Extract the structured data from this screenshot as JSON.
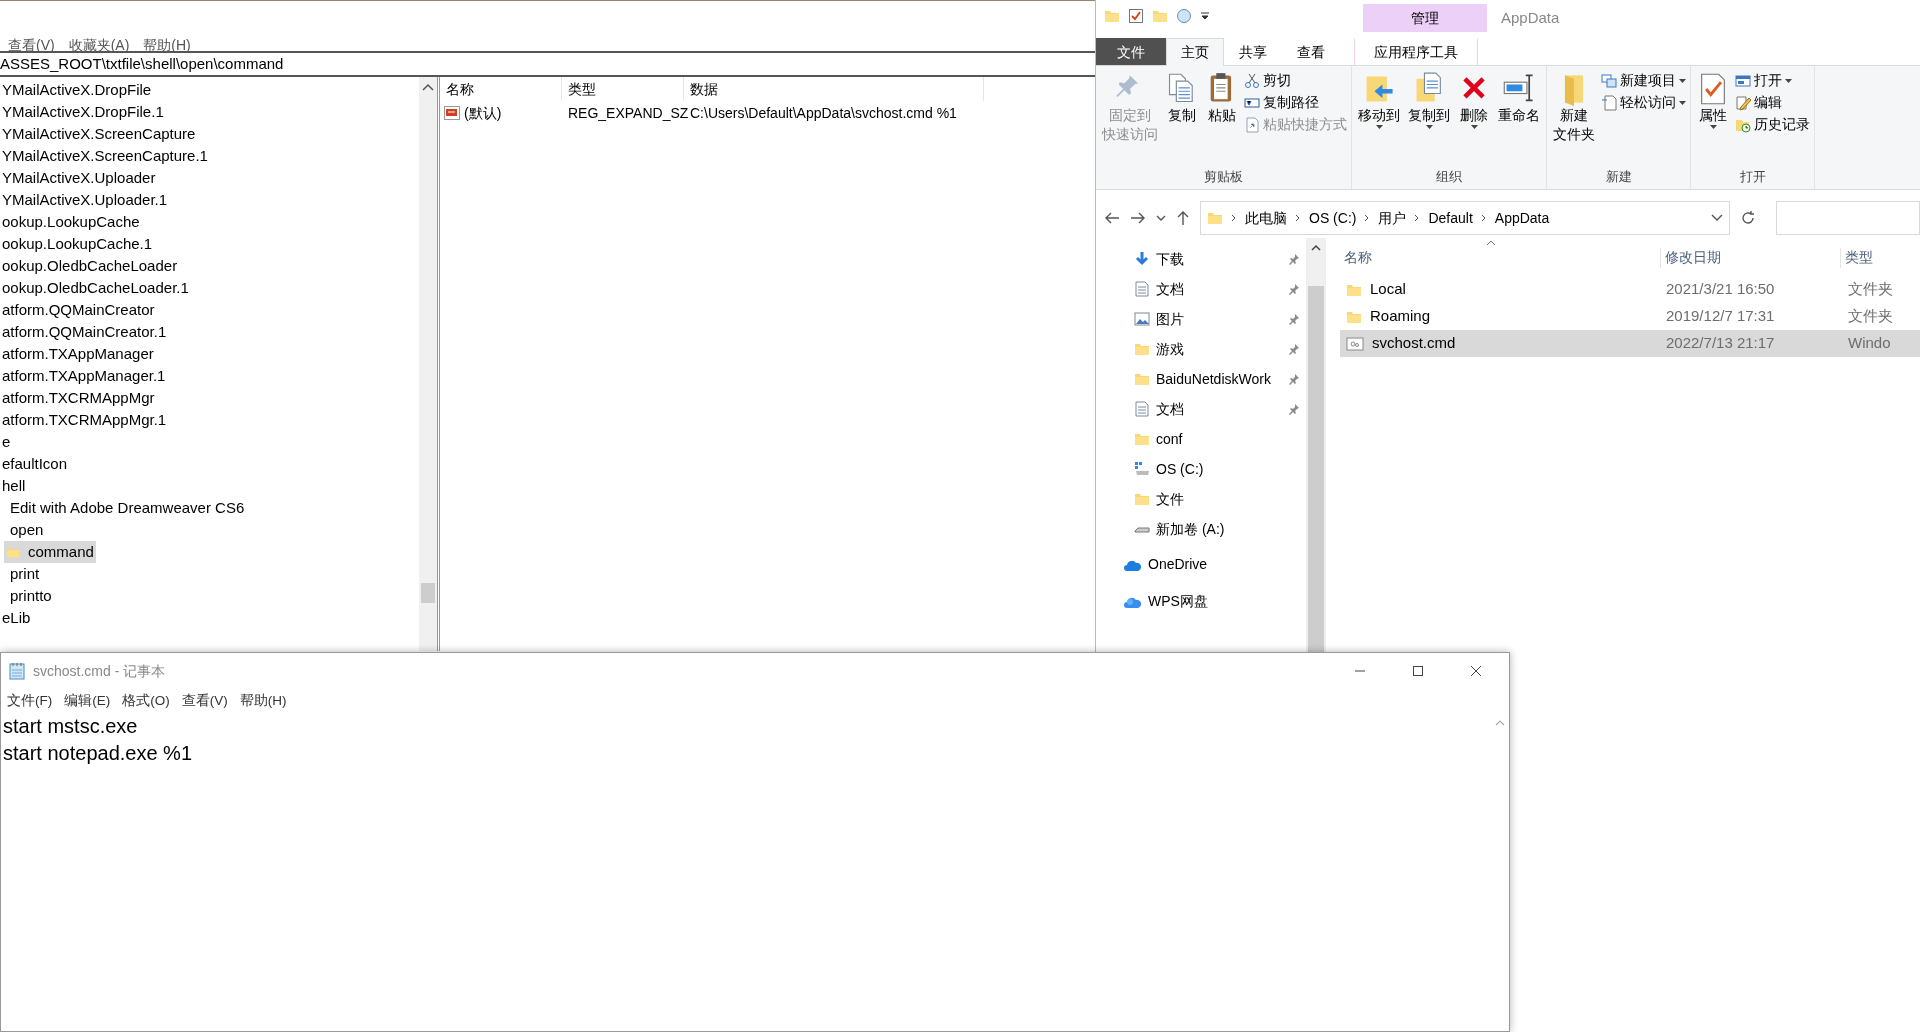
{
  "registry_editor": {
    "menu": [
      "查看(V)",
      "收藏夹(A)",
      "帮助(H)"
    ],
    "address": "ASSES_ROOT\\txtfile\\shell\\open\\command",
    "tree": [
      {
        "label": "YMailActiveX.DropFile",
        "selected": false
      },
      {
        "label": "YMailActiveX.DropFile.1",
        "selected": false
      },
      {
        "label": "YMailActiveX.ScreenCapture",
        "selected": false
      },
      {
        "label": "YMailActiveX.ScreenCapture.1",
        "selected": false
      },
      {
        "label": "YMailActiveX.Uploader",
        "selected": false
      },
      {
        "label": "YMailActiveX.Uploader.1",
        "selected": false
      },
      {
        "label": "ookup.LookupCache",
        "selected": false
      },
      {
        "label": "ookup.LookupCache.1",
        "selected": false
      },
      {
        "label": "ookup.OledbCacheLoader",
        "selected": false
      },
      {
        "label": "ookup.OledbCacheLoader.1",
        "selected": false
      },
      {
        "label": "atform.QQMainCreator",
        "selected": false
      },
      {
        "label": "atform.QQMainCreator.1",
        "selected": false
      },
      {
        "label": "atform.TXAppManager",
        "selected": false
      },
      {
        "label": "atform.TXAppManager.1",
        "selected": false
      },
      {
        "label": "atform.TXCRMAppMgr",
        "selected": false
      },
      {
        "label": "atform.TXCRMAppMgr.1",
        "selected": false
      },
      {
        "label": "e",
        "selected": false,
        "children": [
          {
            "label": "efaultIcon",
            "selected": false
          },
          {
            "label": "hell",
            "selected": false,
            "children": [
              {
                "label": "Edit with Adobe Dreamweaver CS6",
                "selected": false
              },
              {
                "label": "open",
                "selected": false,
                "children": [
                  {
                    "label": "command",
                    "selected": true
                  }
                ]
              },
              {
                "label": "print",
                "selected": false
              },
              {
                "label": "printto",
                "selected": false
              }
            ]
          }
        ]
      },
      {
        "label": "eLib",
        "selected": false
      }
    ],
    "values": {
      "columns": [
        "名称",
        "类型",
        "数据"
      ],
      "rows": [
        {
          "name": "(默认)",
          "type": "REG_EXPAND_SZ",
          "data": "C:\\Users\\Default\\AppData\\svchost.cmd %1"
        }
      ]
    }
  },
  "file_explorer": {
    "contextual_tab": "管理",
    "window_title": "AppData",
    "tabs": [
      {
        "label": "文件",
        "kind": "file",
        "selected": false
      },
      {
        "label": "主页",
        "kind": "normal",
        "selected": true
      },
      {
        "label": "共享",
        "kind": "normal",
        "selected": false
      },
      {
        "label": "查看",
        "kind": "normal",
        "selected": false
      },
      {
        "label": "应用程序工具",
        "kind": "contextual",
        "selected": false
      }
    ],
    "ribbon": [
      {
        "label": "剪贴板",
        "large": [
          {
            "lines": [
              "固定到",
              "快速访问"
            ],
            "disabled": true,
            "dropdown": false
          },
          {
            "lines": [
              "复制"
            ],
            "disabled": false,
            "dropdown": false
          },
          {
            "lines": [
              "粘贴"
            ],
            "disabled": false,
            "dropdown": false
          }
        ],
        "small": [
          {
            "label": "剪切",
            "disabled": false,
            "dropdown": false
          },
          {
            "label": "复制路径",
            "disabled": false,
            "dropdown": false
          },
          {
            "label": "粘贴快捷方式",
            "disabled": true,
            "dropdown": false
          }
        ]
      },
      {
        "label": "组织",
        "large": [
          {
            "lines": [
              "移动到"
            ],
            "disabled": false,
            "dropdown": true
          },
          {
            "lines": [
              "复制到"
            ],
            "disabled": false,
            "dropdown": true
          },
          {
            "lines": [
              "删除"
            ],
            "disabled": false,
            "dropdown": true
          },
          {
            "lines": [
              "重命名"
            ],
            "disabled": false,
            "dropdown": false
          }
        ]
      },
      {
        "label": "新建",
        "large": [
          {
            "lines": [
              "新建",
              "文件夹"
            ],
            "disabled": false,
            "dropdown": false
          }
        ],
        "small": [
          {
            "label": "新建项目",
            "disabled": false,
            "dropdown": true
          },
          {
            "label": "轻松访问",
            "disabled": false,
            "dropdown": true
          }
        ]
      },
      {
        "label": "打开",
        "large": [
          {
            "lines": [
              "属性"
            ],
            "disabled": false,
            "dropdown": true
          }
        ],
        "small": [
          {
            "label": "打开",
            "disabled": false,
            "dropdown": true
          },
          {
            "label": "编辑",
            "disabled": false,
            "dropdown": false
          },
          {
            "label": "历史记录",
            "disabled": false,
            "dropdown": false
          }
        ]
      }
    ],
    "breadcrumbs": [
      "此电脑",
      "OS (C:)",
      "用户",
      "Default",
      "AppData"
    ],
    "nav_pane": [
      {
        "label": "下载",
        "kind": "download",
        "pinned": true
      },
      {
        "label": "文档",
        "kind": "document",
        "pinned": true
      },
      {
        "label": "图片",
        "kind": "picture",
        "pinned": true
      },
      {
        "label": "游戏",
        "kind": "folder",
        "pinned": true
      },
      {
        "label": "BaiduNetdiskWork",
        "kind": "folder",
        "pinned": true
      },
      {
        "label": "文档",
        "kind": "document",
        "pinned": true
      },
      {
        "label": "conf",
        "kind": "folder",
        "pinned": false
      },
      {
        "label": "OS (C:)",
        "kind": "osdrive",
        "pinned": false
      },
      {
        "label": "文件",
        "kind": "folder",
        "pinned": false
      },
      {
        "label": "新加卷 (A:)",
        "kind": "drive",
        "pinned": false
      },
      {
        "label": "OneDrive",
        "kind": "cloud",
        "pinned": false
      },
      {
        "label": "WPS网盘",
        "kind": "cloud2",
        "pinned": false
      }
    ],
    "columns": [
      "名称",
      "修改日期",
      "类型"
    ],
    "files": [
      {
        "name": "Local",
        "kind": "folder",
        "modified": "2021/3/21 16:50",
        "type": "文件夹",
        "selected": false
      },
      {
        "name": "Roaming",
        "kind": "folder",
        "modified": "2019/12/7 17:31",
        "type": "文件夹",
        "selected": false
      },
      {
        "name": "svchost.cmd",
        "kind": "script",
        "modified": "2022/7/13 21:17",
        "type": "Windo",
        "selected": true
      }
    ]
  },
  "notepad": {
    "title": "svchost.cmd - 记事本",
    "menu": [
      "文件(F)",
      "编辑(E)",
      "格式(O)",
      "查看(V)",
      "帮助(H)"
    ],
    "lines": [
      "start mstsc.exe",
      "start notepad.exe %1"
    ]
  }
}
